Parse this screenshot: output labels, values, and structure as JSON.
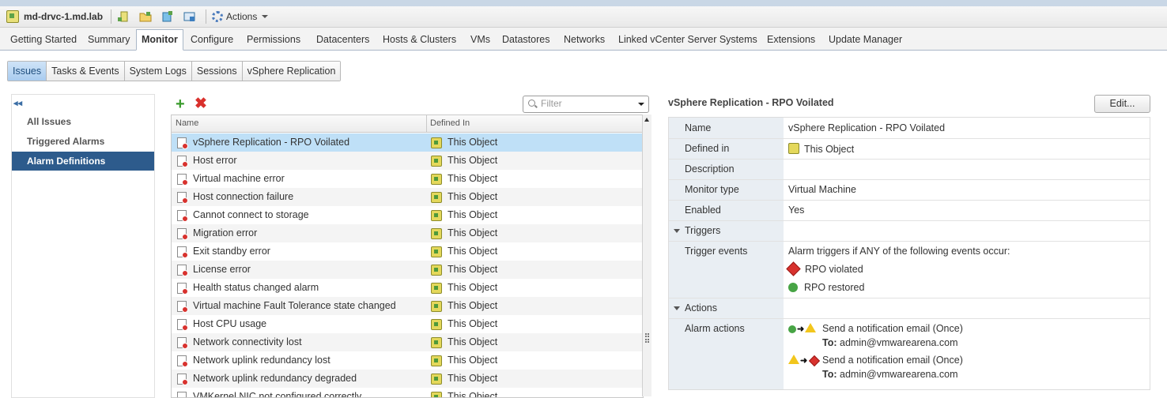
{
  "object_title": "md-drvc-1.md.lab",
  "toolbar": {
    "actions_label": "Actions"
  },
  "main_tabs": [
    {
      "label": "Getting Started"
    },
    {
      "label": "Summary"
    },
    {
      "label": "Monitor"
    },
    {
      "label": "Configure"
    },
    {
      "label": "Permissions"
    },
    {
      "label": "Datacenters"
    },
    {
      "label": "Hosts & Clusters"
    },
    {
      "label": "VMs"
    },
    {
      "label": "Datastores"
    },
    {
      "label": "Networks"
    },
    {
      "label": "Linked vCenter Server Systems"
    },
    {
      "label": "Extensions"
    },
    {
      "label": "Update Manager"
    }
  ],
  "sub_tabs": [
    {
      "label": "Issues"
    },
    {
      "label": "Tasks & Events"
    },
    {
      "label": "System Logs"
    },
    {
      "label": "Sessions"
    },
    {
      "label": "vSphere Replication"
    }
  ],
  "left_nav": [
    {
      "label": "All Issues"
    },
    {
      "label": "Triggered Alarms"
    },
    {
      "label": "Alarm Definitions"
    }
  ],
  "filter": {
    "placeholder": "Filter"
  },
  "grid": {
    "columns": [
      "Name",
      "Defined In"
    ],
    "rows": [
      {
        "name": "vSphere Replication - RPO Voilated",
        "defined_in": "This Object"
      },
      {
        "name": "Host error",
        "defined_in": "This Object"
      },
      {
        "name": "Virtual machine error",
        "defined_in": "This Object"
      },
      {
        "name": "Host connection failure",
        "defined_in": "This Object"
      },
      {
        "name": "Cannot connect to storage",
        "defined_in": "This Object"
      },
      {
        "name": "Migration error",
        "defined_in": "This Object"
      },
      {
        "name": "Exit standby error",
        "defined_in": "This Object"
      },
      {
        "name": "License error",
        "defined_in": "This Object"
      },
      {
        "name": "Health status changed alarm",
        "defined_in": "This Object"
      },
      {
        "name": "Virtual machine Fault Tolerance state changed",
        "defined_in": "This Object"
      },
      {
        "name": "Host CPU usage",
        "defined_in": "This Object"
      },
      {
        "name": "Network connectivity lost",
        "defined_in": "This Object"
      },
      {
        "name": "Network uplink redundancy lost",
        "defined_in": "This Object"
      },
      {
        "name": "Network uplink redundancy degraded",
        "defined_in": "This Object"
      },
      {
        "name": "VMKernel NIC not configured correctly",
        "defined_in": "This Object"
      }
    ]
  },
  "detail": {
    "title": "vSphere Replication - RPO Voilated",
    "edit_label": "Edit...",
    "name_label": "Name",
    "name_value": "vSphere Replication - RPO Voilated",
    "defined_label": "Defined in",
    "defined_value": "This Object",
    "description_label": "Description",
    "monitor_label": "Monitor type",
    "monitor_value": "Virtual Machine",
    "enabled_label": "Enabled",
    "enabled_value": "Yes",
    "triggers_label": "Triggers",
    "trigger_events_label": "Trigger events",
    "trigger_events_intro": "Alarm triggers if ANY of the following events occur:",
    "trigger_1": "RPO violated",
    "trigger_2": "RPO restored",
    "actions_label": "Actions",
    "alarm_actions_label": "Alarm actions",
    "action_1": "Send a notification email (Once)",
    "action_1_to_label": "To:",
    "action_1_to": "admin@vmwarearena.com",
    "action_2": "Send a notification email (Once)",
    "action_2_to_label": "To:",
    "action_2_to": "admin@vmwarearena.com"
  }
}
